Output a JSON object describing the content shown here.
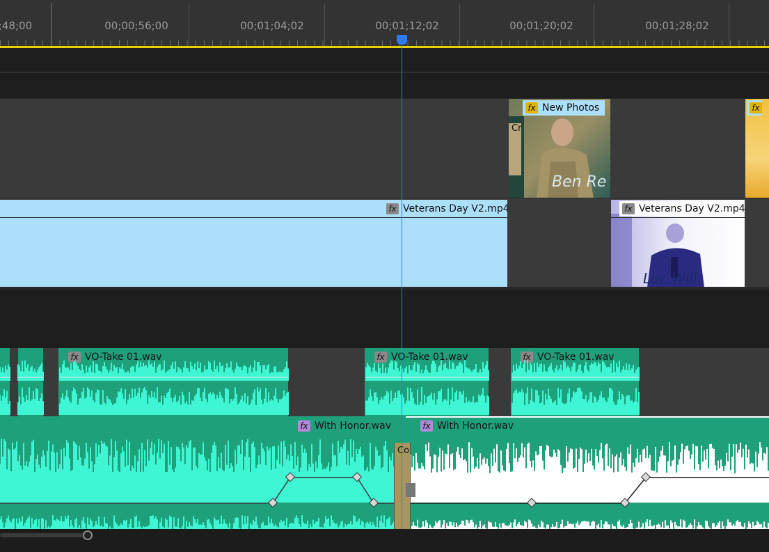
{
  "ruler": {
    "timecodes": [
      "48;00",
      "00;00;56;00",
      "00;01;04;02",
      "00;01;12;02",
      "00;01;20;02",
      "00;01;28;02"
    ],
    "first_timecode_prefix": ";"
  },
  "playhead": {
    "time": "00;01;12;02"
  },
  "colors": {
    "video_clip": "#acdffa",
    "audio_clip": "#1ea07a",
    "waveform": "#3ef5d4",
    "music_selected": "#ffffff",
    "playhead": "#2f7cf0",
    "work_area": "#e8d100",
    "fx_gold": "#e2b300",
    "fx_purple": "#b089d8"
  },
  "clips": {
    "photo1": {
      "label": "New Photos",
      "fx": "gold",
      "transition": "Cr",
      "caption": "Ben Re"
    },
    "photo2": {
      "fx": "gold"
    },
    "video1": {
      "label": "Veterans Day V2.mp4",
      "fx": "gray"
    },
    "video2": {
      "label": "Veterans Day V2.mp4",
      "fx": "gray",
      "caption": "Luc Will"
    },
    "vo1": {
      "label": "VO-Take 01.wav",
      "fx": "gray"
    },
    "vo2": {
      "label": "VO-Take 01.wav",
      "fx": "gray"
    },
    "vo3": {
      "label": "VO-Take 01.wav",
      "fx": "gray"
    },
    "music1": {
      "label": "With Honor.wav",
      "fx": "purple"
    },
    "music2": {
      "label": "With Honor.wav",
      "fx": "purple"
    },
    "crossfade": {
      "label": "Co"
    }
  },
  "fx_text": "fx",
  "icons": {
    "fx_badge": "fx-icon",
    "playhead": "playhead-marker-icon",
    "keyframe": "keyframe-icon",
    "scroll": "scroll-handle-icon"
  }
}
